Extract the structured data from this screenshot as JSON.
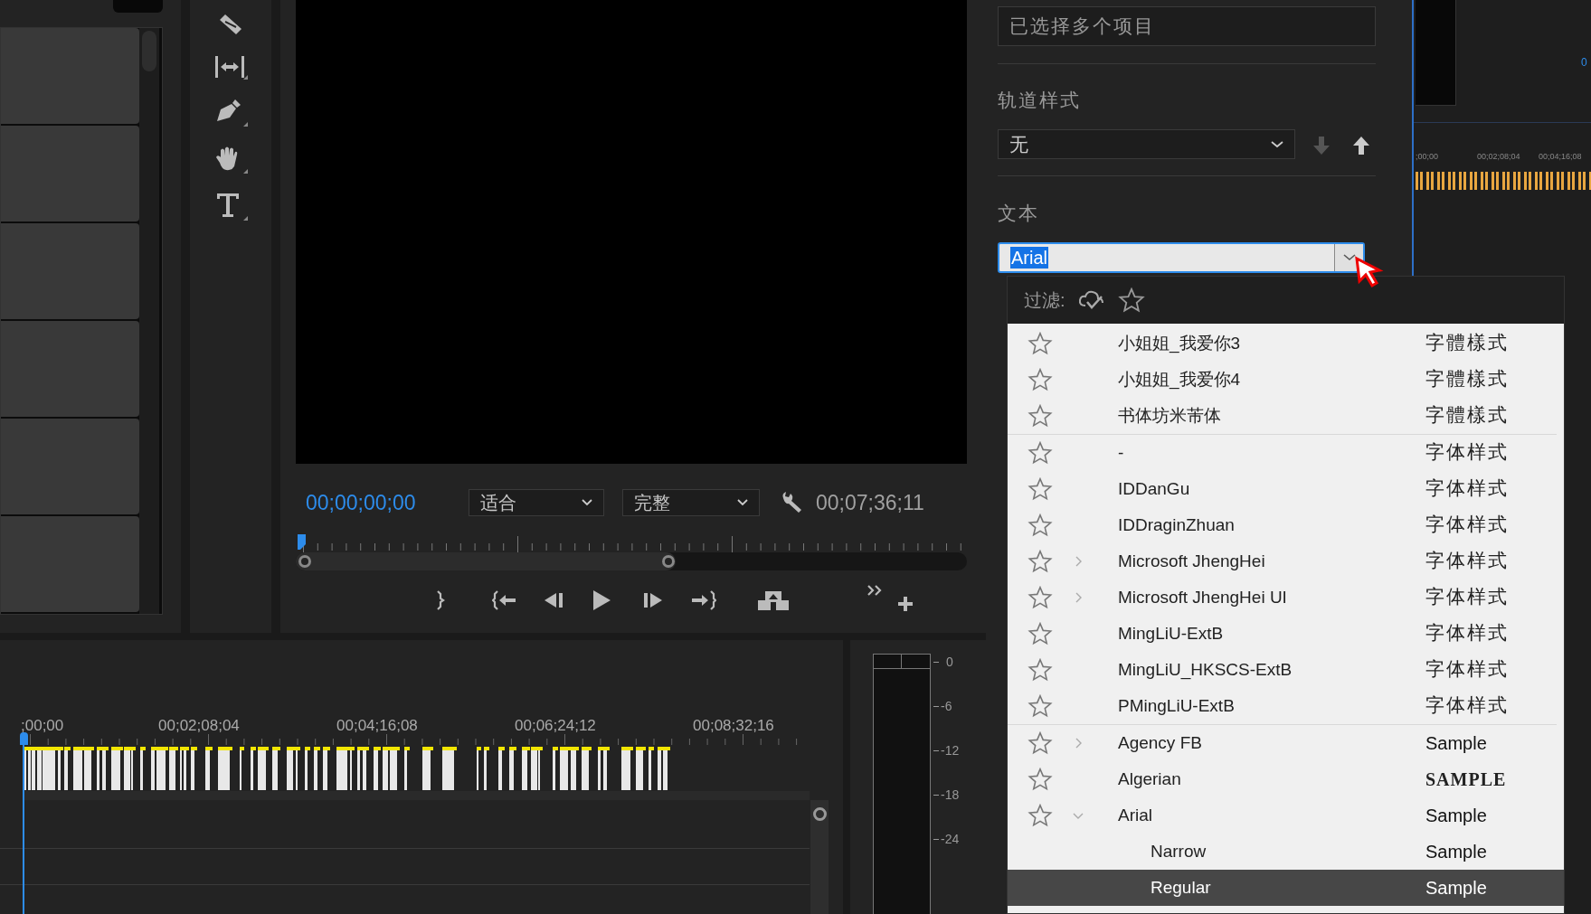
{
  "program_monitor": {
    "current_time": "00;00;00;00",
    "zoom": "适合",
    "quality": "完整",
    "duration": "00;07;36;11"
  },
  "timeline": {
    "ruler": [
      ";00;00",
      "00;02;08;04",
      "00;04;16;08",
      "00;06;24;12",
      "00;08;32;16"
    ]
  },
  "audio_meter": {
    "scale": [
      "0",
      "-6",
      "-12",
      "-18",
      "-24"
    ]
  },
  "properties": {
    "selection": "已选择多个项目",
    "track_style_label": "轨道样式",
    "track_style": "无",
    "text_label": "文本",
    "font_field": "Arial"
  },
  "font_menu": {
    "filter_label": "过滤:",
    "groups": [
      {
        "items": [
          {
            "name": "小姐姐_我爱你3",
            "sample": "字體樣式",
            "kind": "cjk"
          },
          {
            "name": "小姐姐_我爱你4",
            "sample": "字體樣式",
            "kind": "cjk"
          },
          {
            "name": "书体坊米芾体",
            "sample": "字體樣式",
            "kind": "cjk"
          }
        ]
      },
      {
        "items": [
          {
            "name": "-",
            "sample": "字体样式",
            "kind": "cjk"
          },
          {
            "name": "IDDanGu",
            "sample": "字体样式",
            "kind": "cjk"
          },
          {
            "name": "IDDraginZhuan",
            "sample": "字体样式",
            "kind": "cjk"
          },
          {
            "name": "Microsoft JhengHei",
            "sample": "字体样式",
            "kind": "cjk",
            "expanded": false
          },
          {
            "name": "Microsoft JhengHei UI",
            "sample": "字体样式",
            "kind": "cjk",
            "expanded": false
          },
          {
            "name": "MingLiU-ExtB",
            "sample": "字体样式",
            "kind": "cjk"
          },
          {
            "name": "MingLiU_HKSCS-ExtB",
            "sample": "字体样式",
            "kind": "cjk"
          },
          {
            "name": "PMingLiU-ExtB",
            "sample": "字体样式",
            "kind": "cjk"
          }
        ]
      },
      {
        "items": [
          {
            "name": "Agency FB",
            "sample": "Sample",
            "kind": "latin",
            "expanded": false
          },
          {
            "name": "Algerian",
            "sample": "SAMPLE",
            "kind": "display"
          },
          {
            "name": "Arial",
            "sample": "Sample",
            "kind": "latin",
            "expanded": true,
            "children": [
              {
                "name": "Narrow",
                "sample": "Sample",
                "kind": "latin",
                "selected": false
              },
              {
                "name": "Regular",
                "sample": "Sample",
                "kind": "latin",
                "selected": true
              }
            ]
          }
        ]
      }
    ]
  },
  "mini_timeline": {
    "ruler": [
      ";00;00",
      "00;02;08;04",
      "00;04;16;08"
    ],
    "edge_label": "0"
  }
}
